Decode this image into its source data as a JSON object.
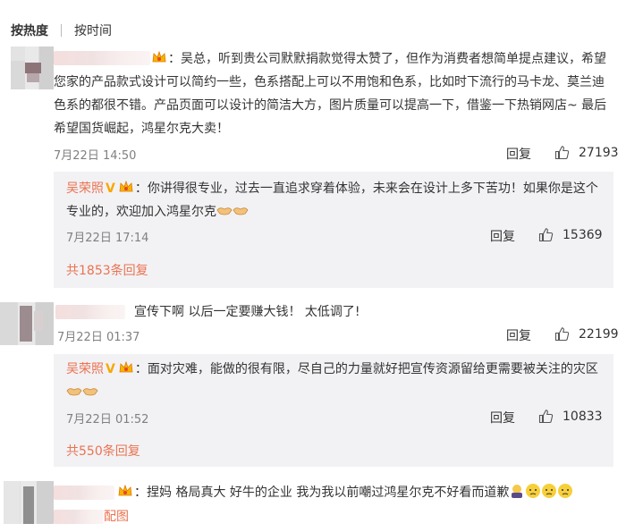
{
  "tabs": {
    "hot": "按热度",
    "time": "按时间"
  },
  "comments": [
    {
      "text": "：吴总，听到贵公司默默捐款觉得太赞了，但作为消费者想简单提点建议，希望您家的产品款式设计可以简约一些，色系搭配上可以不用饱和色系，比如时下流行的马卡龙、莫兰迪色系的都很不错。产品页面可以设计的简洁大方，图片质量可以提高一下，借鉴一下热销网店~ 最后希望国货崛起，鸿星尔克大卖！",
      "time": "7月22日 14:50",
      "reply_label": "回复",
      "likes": "27193",
      "reply": {
        "user": "吴荣照",
        "text": "：你讲得很专业，过去一直追求穿着体验，未来会在设计上多下苦功！如果你是这个专业的，欢迎加入鸿星尔克",
        "time": "7月22日 17:14",
        "reply_label": "回复",
        "likes": "15369"
      },
      "more": "共1853条回复"
    },
    {
      "text": "宣传下啊 以后一定要赚大钱！ 太低调了!",
      "time": "7月22日 01:37",
      "reply_label": "回复",
      "likes": "22199",
      "reply": {
        "user": "吴荣照",
        "text": "：面对灾难，能做的很有限，尽自己的力量就好把宣传资源留给更需要被关注的灾区",
        "time": "7月22日 01:52",
        "reply_label": "回复",
        "likes": "10833"
      },
      "more": "共550条回复"
    },
    {
      "text": "：捏妈 格局真大 好牛的企业 我为我以前嘲过鸿星尔克不好看而道歉",
      "tail": "配图"
    }
  ],
  "colors": {
    "accent": "#eb7350",
    "reply_bg": "#f2f2f5",
    "muted": "#808080",
    "gold": "#f7a800"
  },
  "icons": [
    "thumb-up-icon",
    "crown-icon",
    "verified-v-icon",
    "handshake-emoji",
    "worried-emoji"
  ]
}
